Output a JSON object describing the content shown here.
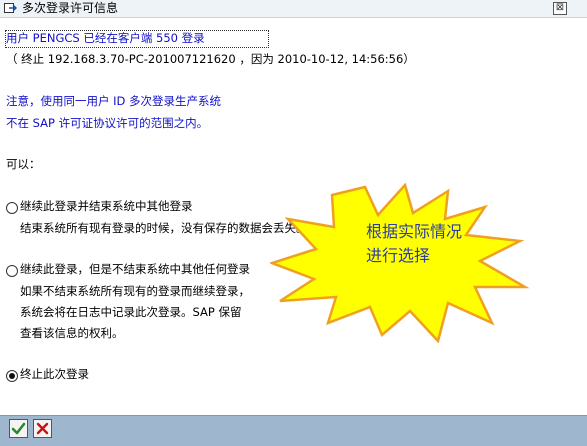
{
  "window": {
    "title": "多次登录许可信息",
    "close_glyph": "⊠"
  },
  "message": {
    "line1": "用户 PENGCS 已经在客户端 550 登录",
    "line2": "（ 终止 192.168.3.70-PC-201007121620 ，因为 2010-10-12, 14:56:56）",
    "note1": "注意，使用同一用户 ID 多次登录生产系统",
    "note2": "不在 SAP 许可证协议许可的范围之内。",
    "options_intro": "可以："
  },
  "options": [
    {
      "label": "继续此登录并结束系统中其他登录",
      "desc": [
        "结束系统所有现有登录的时候，没有保存的数据会丢失。"
      ],
      "selected": false
    },
    {
      "label": "继续此登录，但是不结束系统中其他任何登录",
      "desc": [
        "如果不结束系统所有现有的登录而继续登录，",
        "系统会将在日志中记录此次登录。SAP 保留",
        "查看该信息的权利。"
      ],
      "selected": false
    },
    {
      "label": "终止此次登录",
      "desc": [],
      "selected": true
    }
  ],
  "annotation": {
    "line1": "根据实际情况",
    "line2": "进行选择",
    "fill_color": "#ffff00",
    "outline_color": "#f0a020"
  },
  "toolbar": {
    "confirm_icon": "checkmark-icon",
    "cancel_icon": "cancel-x-icon"
  },
  "colors": {
    "note_text": "#1010c8",
    "bottom_bar": "#9fb6cf",
    "confirm_green": "#2a8a2a",
    "cancel_red": "#cc1111"
  }
}
